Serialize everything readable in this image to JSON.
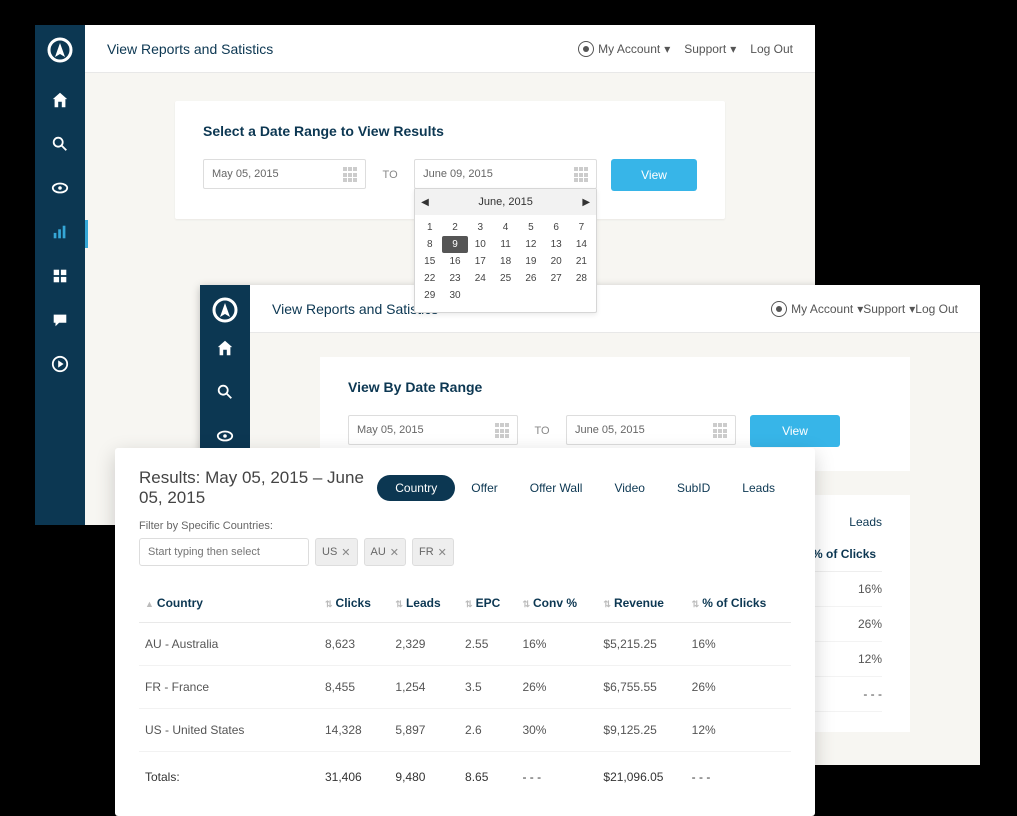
{
  "brand": {
    "logo_label": "A"
  },
  "header": {
    "title": "View Reports and Satistics",
    "account_label": "My Account",
    "support_label": "Support",
    "logout_label": "Log Out"
  },
  "sidebar_icons": [
    "home",
    "search",
    "eye",
    "chart",
    "grid",
    "comment",
    "play"
  ],
  "panelA": {
    "card_title": "Select a Date Range to View Results",
    "from_date": "May 05, 2015",
    "to_date": "June 09, 2015",
    "to_label": "TO",
    "view_label": "View",
    "calendar": {
      "month_label": "June, 2015",
      "selected": 9,
      "days": [
        1,
        2,
        3,
        4,
        5,
        6,
        7,
        8,
        9,
        10,
        11,
        12,
        13,
        14,
        15,
        16,
        17,
        18,
        19,
        20,
        21,
        22,
        23,
        24,
        25,
        26,
        27,
        28,
        29,
        30
      ]
    }
  },
  "panelB": {
    "card_title": "View By Date Range",
    "from_date": "May 05, 2015",
    "to_date": "June 05, 2015",
    "to_label": "TO",
    "view_label": "View",
    "tabs": [
      "Country",
      "Offer",
      "Offer Wall",
      "Video",
      "SubID",
      "Leads"
    ],
    "peek_tab": "Leads",
    "peek_col": "% of Clicks",
    "peek_rows": [
      "16%",
      "26%",
      "12%",
      "- - -"
    ]
  },
  "panelC": {
    "title": "Results: May 05, 2015 – June 05, 2015",
    "tabs": [
      "Country",
      "Offer",
      "Offer Wall",
      "Video",
      "SubID",
      "Leads"
    ],
    "active_tab": "Country",
    "filter_label": "Filter by Specific Countries:",
    "filter_placeholder": "Start typing then select",
    "chips": [
      "US",
      "AU",
      "FR"
    ],
    "columns": [
      "Country",
      "Clicks",
      "Leads",
      "EPC",
      "Conv %",
      "Revenue",
      "% of Clicks"
    ],
    "rows": [
      {
        "country": "AU - Australia",
        "clicks": "8,623",
        "leads": "2,329",
        "epc": "2.55",
        "conv": "16%",
        "revenue": "$5,215.25",
        "pct": "16%"
      },
      {
        "country": "FR - France",
        "clicks": "8,455",
        "leads": "1,254",
        "epc": "3.5",
        "conv": "26%",
        "revenue": "$6,755.55",
        "pct": "26%"
      },
      {
        "country": "US - United States",
        "clicks": "14,328",
        "leads": "5,897",
        "epc": "2.6",
        "conv": "30%",
        "revenue": "$9,125.25",
        "pct": "12%"
      }
    ],
    "totals": {
      "label": "Totals:",
      "clicks": "31,406",
      "leads": "9,480",
      "epc": "8.65",
      "conv": "- - -",
      "revenue": "$21,096.05",
      "pct": "- - -"
    }
  }
}
